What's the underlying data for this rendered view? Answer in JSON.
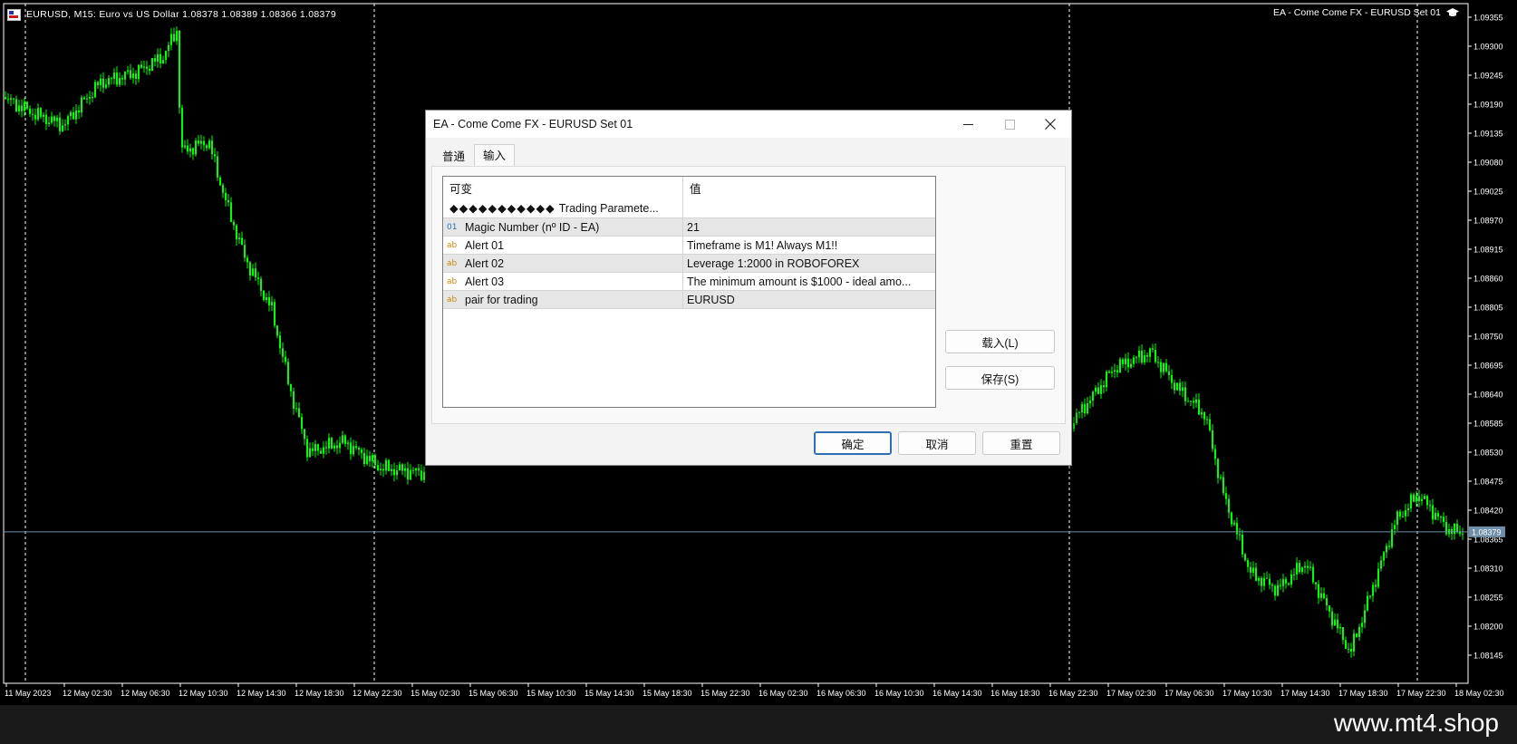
{
  "chart": {
    "symbol_info": "EURUSD, M15:  Euro vs US Dollar  1.08378 1.08389 1.08366 1.08379",
    "ea_label": "EA - Come Come FX - EURUSD Set 01",
    "current_price": "1.08379",
    "price_labels": [
      "1.09355",
      "1.09300",
      "1.09245",
      "1.09190",
      "1.09135",
      "1.09080",
      "1.09025",
      "1.08970",
      "1.08915",
      "1.08860",
      "1.08805",
      "1.08750",
      "1.08695",
      "1.08640",
      "1.08585",
      "1.08530",
      "1.08475",
      "1.08420",
      "1.08365",
      "1.08310",
      "1.08255",
      "1.08200",
      "1.08145"
    ],
    "time_labels": [
      "11 May 2023",
      "12 May 02:30",
      "12 May 06:30",
      "12 May 10:30",
      "12 May 14:30",
      "12 May 18:30",
      "12 May 22:30",
      "15 May 02:30",
      "15 May 06:30",
      "15 May 10:30",
      "15 May 14:30",
      "15 May 18:30",
      "15 May 22:30",
      "16 May 02:30",
      "16 May 06:30",
      "16 May 10:30",
      "16 May 14:30",
      "16 May 18:30",
      "16 May 22:30",
      "17 May 02:30",
      "17 May 06:30",
      "17 May 10:30",
      "17 May 14:30",
      "17 May 18:30",
      "17 May 22:30",
      "18 May 02:30"
    ],
    "candle_color": "#00ff00",
    "price_line_color": "#6f8fa8"
  },
  "dialog": {
    "title": "EA - Come Come FX - EURUSD Set 01",
    "tabs": [
      {
        "label": "普通",
        "active": false
      },
      {
        "label": "输入",
        "active": true
      }
    ],
    "table": {
      "header_variable": "可变",
      "header_value": "值",
      "group_label": "Trading Paramete...",
      "group_diamonds": "◆◆◆◆◆◆◆◆◆◆◆",
      "rows": [
        {
          "type": "01",
          "name": "Magic Number (nº ID - EA)",
          "value": "21"
        },
        {
          "type": "ab",
          "name": "Alert 01",
          "value": "Timeframe is M1! Always M1!!"
        },
        {
          "type": "ab",
          "name": "Alert 02",
          "value": "Leverage 1:2000 in ROBOFOREX"
        },
        {
          "type": "ab",
          "name": "Alert 03",
          "value": "The minimum amount is $1000 - ideal amo..."
        },
        {
          "type": "ab",
          "name": "pair for trading",
          "value": "EURUSD"
        }
      ]
    },
    "buttons": {
      "load": "载入(L)",
      "save": "保存(S)",
      "ok": "确定",
      "cancel": "取消",
      "reset": "重置"
    }
  },
  "watermark": "www.mt4.shop",
  "icons": {
    "flag": "flag-icon",
    "hat": "graduation-cap-icon",
    "minimize": "minimize-icon",
    "maximize": "maximize-icon",
    "close": "close-icon"
  }
}
